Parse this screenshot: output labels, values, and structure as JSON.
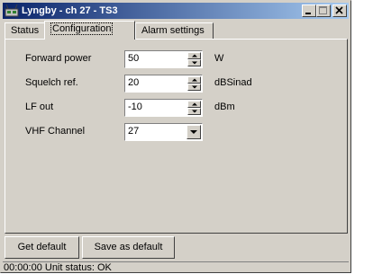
{
  "window": {
    "title": "Lyngby - ch 27 - TS3",
    "buttons": {
      "minimize": "_",
      "maximize": "□",
      "close": "×"
    }
  },
  "tabs": [
    {
      "label": "Status",
      "active": false
    },
    {
      "label": "Configuration",
      "active": true
    },
    {
      "label": "Alarm settings",
      "active": false
    }
  ],
  "form": {
    "forward_power": {
      "label": "Forward power",
      "value": "50",
      "unit": "W"
    },
    "squelch_ref": {
      "label": "Squelch ref.",
      "value": "20",
      "unit": "dBSinad"
    },
    "lf_out": {
      "label": "LF out",
      "value": "-10",
      "unit": "dBm"
    },
    "vhf_channel": {
      "label": "VHF Channel",
      "value": "27"
    }
  },
  "actions": {
    "get_default": "Get default",
    "save_as_default": "Save as default"
  },
  "status": "00:00:00 Unit status: OK",
  "colors": {
    "face": "#d4d0c8",
    "title_start": "#0a246a",
    "title_end": "#a6caf0"
  }
}
